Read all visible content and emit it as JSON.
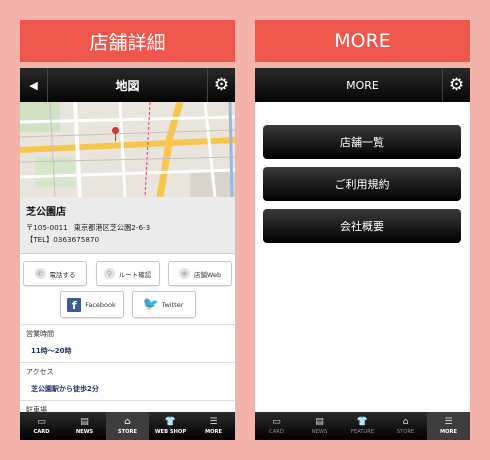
{
  "left": {
    "header": "店舗詳細",
    "nav": {
      "back": "◀",
      "title": "地図",
      "gear": "⚙"
    },
    "store": {
      "name": "芝公園店",
      "postal": "〒105-0011",
      "address": "東京都港区芝公園2-6-3",
      "tel": "【TEL】0363675870"
    },
    "buttons": {
      "phone": "電話する",
      "route": "ルート確認",
      "web": "店舗Web",
      "facebook": "Facebook",
      "twitter": "Twitter"
    },
    "info": [
      {
        "label": "営業時間",
        "value": "11時〜20時"
      },
      {
        "label": "アクセス",
        "value": "芝公園駅から徒歩2分"
      },
      {
        "label": "駐車場",
        "value": ""
      }
    ],
    "tabs": [
      {
        "label": "CARD",
        "icon": "▭"
      },
      {
        "label": "NEWS",
        "icon": "▤"
      },
      {
        "label": "STORE",
        "icon": "⌂"
      },
      {
        "label": "WEB SHOP",
        "icon": "👕"
      },
      {
        "label": "MORE",
        "icon": "☰"
      }
    ]
  },
  "right": {
    "header": "MORE",
    "nav": {
      "title": "MORE",
      "gear": "⚙"
    },
    "menu": [
      "店舗一覧",
      "ご利用規約",
      "会社概要"
    ],
    "tabs": [
      {
        "label": "CARD",
        "icon": "▭"
      },
      {
        "label": "NEWS",
        "icon": "▤"
      },
      {
        "label": "FEATURE",
        "icon": "👕"
      },
      {
        "label": "STORE",
        "icon": "⌂"
      },
      {
        "label": "MORE",
        "icon": "☰"
      }
    ]
  },
  "colors": {
    "background": "#f3b3ab",
    "header": "#f0574c",
    "nav_text": "#1c2e5c",
    "map_pin": "#d8342a"
  }
}
